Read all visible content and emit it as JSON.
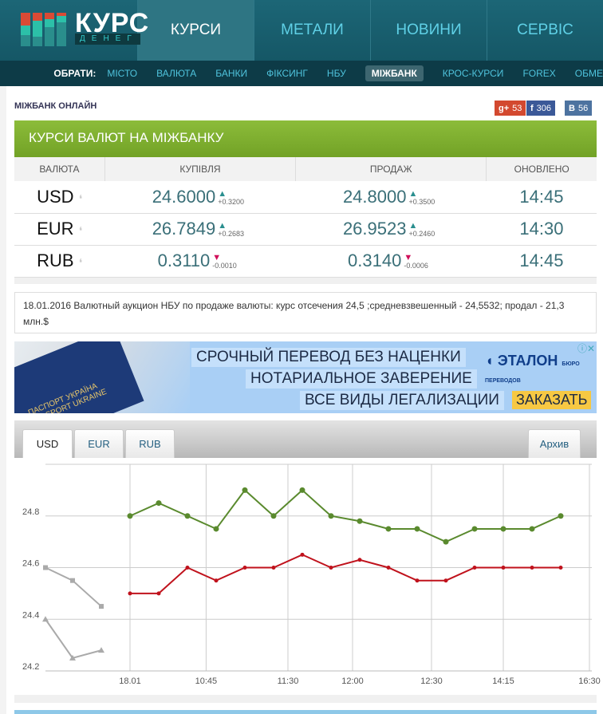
{
  "logo": {
    "title": "КУРС",
    "subtitle": "ДЕНЕГ"
  },
  "nav": [
    "КУРСИ",
    "МЕТАЛИ",
    "НОВИНИ",
    "СЕРВІС"
  ],
  "subnav": {
    "label": "ОБРАТИ:",
    "items": [
      "МІСТО",
      "ВАЛЮТА",
      "БАНКИ",
      "ФІКСИНГ",
      "НБУ",
      "МІЖБАНК",
      "КРОС-КУРСИ",
      "FOREX",
      "ОБМЕ"
    ]
  },
  "page_title": "МІЖБАНК ОНЛАЙН",
  "social": {
    "gplus": "53",
    "facebook": "306",
    "vk": "56"
  },
  "panel_title": "КУРСИ ВАЛЮТ НА МІЖБАНКУ",
  "table": {
    "headers": [
      "ВАЛЮТА",
      "КУПІВЛЯ",
      "ПРОДАЖ",
      "ОНОВЛЕНО"
    ],
    "rows": [
      {
        "cur": "USD",
        "buy": "24.6000",
        "buy_chg": "+0.3200",
        "buy_dir": "up",
        "sell": "24.8000",
        "sell_chg": "+0.3500",
        "sell_dir": "up",
        "time": "14:45"
      },
      {
        "cur": "EUR",
        "buy": "26.7849",
        "buy_chg": "+0.2683",
        "buy_dir": "up",
        "sell": "26.9523",
        "sell_chg": "+0.2460",
        "sell_dir": "up",
        "time": "14:30"
      },
      {
        "cur": "RUB",
        "buy": "0.3110",
        "buy_chg": "-0.0010",
        "buy_dir": "down",
        "sell": "0.3140",
        "sell_chg": "-0.0006",
        "sell_dir": "down",
        "time": "14:45"
      }
    ]
  },
  "news": "18.01.2016 Валютный аукцион НБУ по продаже валюты: курс отсечения 24,5 ;средневзвешенный - 24,5532; продал - 21,3 млн.$",
  "ad": {
    "lines": [
      "СРОЧНЫЙ ПЕРЕВОД БЕЗ НАЦЕНКИ",
      "НОТАРИАЛЬНОЕ ЗАВЕРЕНИЕ",
      "ВСЕ ВИДЫ ЛЕГАЛИЗАЦИИ"
    ],
    "brand": "ЭТАЛОН",
    "brand_sub": "БЮРО ПЕРЕВОДОВ",
    "cta": "ЗАКАЗАТЬ",
    "passport": "ПАСПОРТ УКРАЇНА PASSPORT UKRAINE"
  },
  "chart_tabs": [
    "USD",
    "EUR",
    "RUB"
  ],
  "archive": "Архив",
  "chart_data": {
    "type": "line",
    "ylim": [
      24.2,
      25.0
    ],
    "yticks": [
      "24.2",
      "24.4",
      "24.6",
      "24.8"
    ],
    "xticks": [
      {
        "label": "18.01",
        "i": 0
      },
      {
        "label": "10:45",
        "i": 2.65
      },
      {
        "label": "11:30",
        "i": 5.5
      },
      {
        "label": "12:00",
        "i": 7.75
      },
      {
        "label": "12:30",
        "i": 10.5
      },
      {
        "label": "14:15",
        "i": 13
      },
      {
        "label": "16:30",
        "i": 16
      }
    ],
    "series": [
      {
        "name": "sell",
        "color": "#5a8a2e",
        "start": 0,
        "values": [
          24.8,
          24.85,
          24.8,
          24.75,
          24.9,
          24.8,
          24.9,
          24.8,
          24.78,
          24.75,
          24.75,
          24.7,
          24.75,
          24.75,
          24.75,
          24.8
        ]
      },
      {
        "name": "buy",
        "color": "#c0121c",
        "start": 0,
        "values": [
          24.5,
          24.5,
          24.6,
          24.55,
          24.6,
          24.6,
          24.65,
          24.6,
          24.63,
          24.6,
          24.55,
          24.55,
          24.6,
          24.6,
          24.6,
          24.6
        ]
      },
      {
        "name": "prev-sell",
        "color": "#aaaaaa",
        "start": -3,
        "values": [
          24.6,
          24.55,
          24.45
        ]
      },
      {
        "name": "prev-buy",
        "color": "#aaaaaa",
        "start": -3,
        "values": [
          24.4,
          24.25,
          24.28
        ]
      }
    ]
  }
}
